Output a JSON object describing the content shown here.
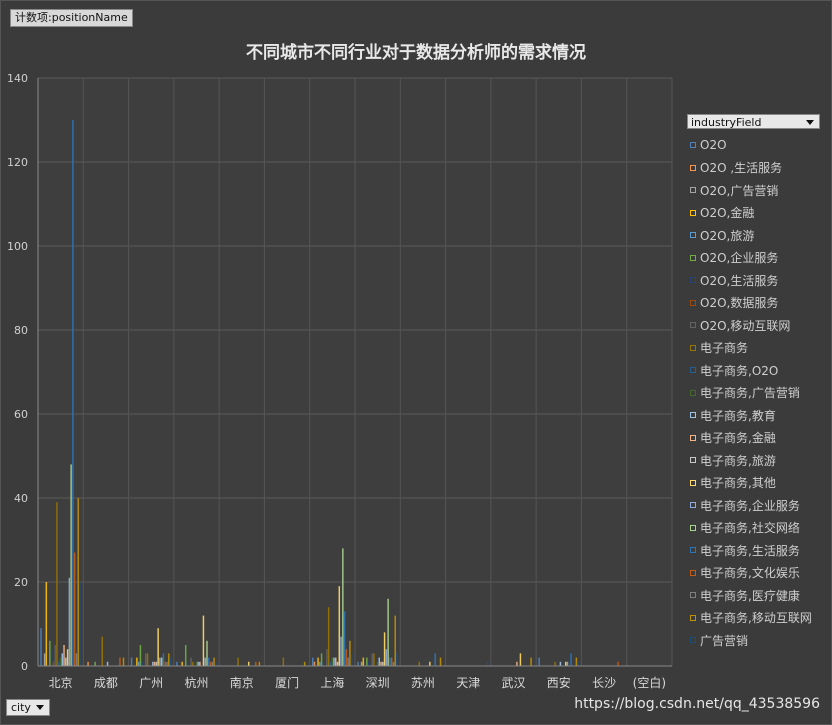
{
  "field_button": "计数项:positionName",
  "legend_field": "industryField",
  "city_field": "city",
  "watermark": "https://blog.csdn.net/qq_43538596",
  "chart_data": {
    "type": "bar",
    "title": "不同城市不同行业对于数据分析师的需求情况",
    "ylim": [
      0,
      140
    ],
    "yticks": [
      0,
      20,
      40,
      60,
      80,
      100,
      120,
      140
    ],
    "grid": true,
    "legend_position": "right",
    "categories": [
      "北京",
      "成都",
      "广州",
      "杭州",
      "南京",
      "厦门",
      "上海",
      "深圳",
      "苏州",
      "天津",
      "武汉",
      "西安",
      "长沙",
      "(空白)"
    ],
    "series": [
      {
        "name": "O2O",
        "color": "#4f81bd",
        "values": [
          9,
          0,
          2,
          1,
          0,
          0,
          2,
          1,
          0,
          0,
          0,
          2,
          0,
          0
        ]
      },
      {
        "name": "O2O ,生活服务",
        "color": "#f79646",
        "values": [
          0,
          1,
          0,
          0,
          0,
          0,
          1,
          0,
          0,
          0,
          0,
          0,
          0,
          0
        ]
      },
      {
        "name": "O2O,广告营销",
        "color": "#a5a5a5",
        "values": [
          3,
          0,
          0,
          0,
          0,
          0,
          0,
          1,
          0,
          0,
          0,
          0,
          0,
          0
        ]
      },
      {
        "name": "O2O,金融",
        "color": "#ffc000",
        "values": [
          20,
          0,
          2,
          1,
          0,
          0,
          2,
          2,
          0,
          0,
          0,
          0,
          0,
          0
        ]
      },
      {
        "name": "O2O,旅游",
        "color": "#5b9bd5",
        "values": [
          0,
          0,
          1,
          0,
          0,
          0,
          1,
          0,
          0,
          0,
          0,
          0,
          0,
          0
        ]
      },
      {
        "name": "O2O,企业服务",
        "color": "#70ad47",
        "values": [
          6,
          1,
          5,
          5,
          0,
          0,
          3,
          2,
          0,
          0,
          0,
          0,
          0,
          0
        ]
      },
      {
        "name": "O2O,生活服务",
        "color": "#264478",
        "values": [
          4,
          0,
          1,
          1,
          0,
          0,
          1,
          1,
          0,
          0,
          0,
          0,
          0,
          0
        ]
      },
      {
        "name": "O2O,数据服务",
        "color": "#9e480e",
        "values": [
          1,
          0,
          0,
          0,
          0,
          0,
          0,
          0,
          0,
          0,
          0,
          0,
          0,
          0
        ]
      },
      {
        "name": "O2O,移动互联网",
        "color": "#636363",
        "values": [
          5,
          0,
          3,
          2,
          0,
          0,
          4,
          3,
          0,
          0,
          0,
          0,
          0,
          0
        ]
      },
      {
        "name": "电子商务",
        "color": "#997300",
        "values": [
          39,
          7,
          3,
          1,
          2,
          2,
          14,
          3,
          1,
          0,
          0,
          1,
          0,
          0
        ]
      },
      {
        "name": "电子商务,O2O",
        "color": "#255e91",
        "values": [
          1,
          0,
          0,
          0,
          0,
          0,
          1,
          0,
          0,
          0,
          0,
          0,
          0,
          0
        ]
      },
      {
        "name": "电子商务,广告营销",
        "color": "#43682b",
        "values": [
          2,
          0,
          0,
          1,
          0,
          0,
          2,
          1,
          0,
          0,
          0,
          0,
          0,
          0
        ]
      },
      {
        "name": "电子商务,教育",
        "color": "#9dc3e6",
        "values": [
          3,
          1,
          1,
          1,
          0,
          0,
          2,
          2,
          0,
          0,
          0,
          1,
          0,
          0
        ]
      },
      {
        "name": "电子商务,金融",
        "color": "#f4b183",
        "values": [
          5,
          0,
          1,
          1,
          0,
          0,
          2,
          1,
          0,
          0,
          1,
          0,
          0,
          0
        ]
      },
      {
        "name": "电子商务,旅游",
        "color": "#c9c9c9",
        "values": [
          2,
          0,
          1,
          0,
          0,
          0,
          1,
          1,
          0,
          0,
          0,
          0,
          0,
          0
        ]
      },
      {
        "name": "电子商务,其他",
        "color": "#ffd966",
        "values": [
          4,
          0,
          9,
          12,
          1,
          0,
          19,
          8,
          1,
          0,
          3,
          1,
          0,
          0
        ]
      },
      {
        "name": "电子商务,企业服务",
        "color": "#8faadc",
        "values": [
          21,
          0,
          2,
          2,
          0,
          0,
          7,
          4,
          0,
          0,
          0,
          1,
          0,
          0
        ]
      },
      {
        "name": "电子商务,社交网络",
        "color": "#a9d18e",
        "values": [
          48,
          0,
          2,
          6,
          0,
          0,
          28,
          16,
          0,
          0,
          0,
          0,
          0,
          0
        ]
      },
      {
        "name": "电子商务,生活服务",
        "color": "#2e75b6",
        "values": [
          130,
          0,
          3,
          2,
          0,
          0,
          13,
          2,
          3,
          0,
          0,
          3,
          0,
          0
        ]
      },
      {
        "name": "电子商务,文化娱乐",
        "color": "#c55a11",
        "values": [
          27,
          2,
          1,
          1,
          1,
          0,
          4,
          2,
          0,
          0,
          0,
          0,
          1,
          0
        ]
      },
      {
        "name": "电子商务,医疗健康",
        "color": "#7f7f7f",
        "values": [
          3,
          0,
          1,
          1,
          0,
          0,
          2,
          1,
          0,
          0,
          0,
          0,
          0,
          0
        ]
      },
      {
        "name": "电子商务,移动互联网",
        "color": "#bf9000",
        "values": [
          40,
          2,
          3,
          2,
          1,
          1,
          6,
          12,
          2,
          0,
          2,
          2,
          0,
          0
        ]
      },
      {
        "name": "广告营销",
        "color": "#1f4e79",
        "values": [
          20,
          0,
          2,
          1,
          0,
          0,
          3,
          3,
          0,
          1,
          0,
          1,
          0,
          0
        ]
      }
    ]
  }
}
